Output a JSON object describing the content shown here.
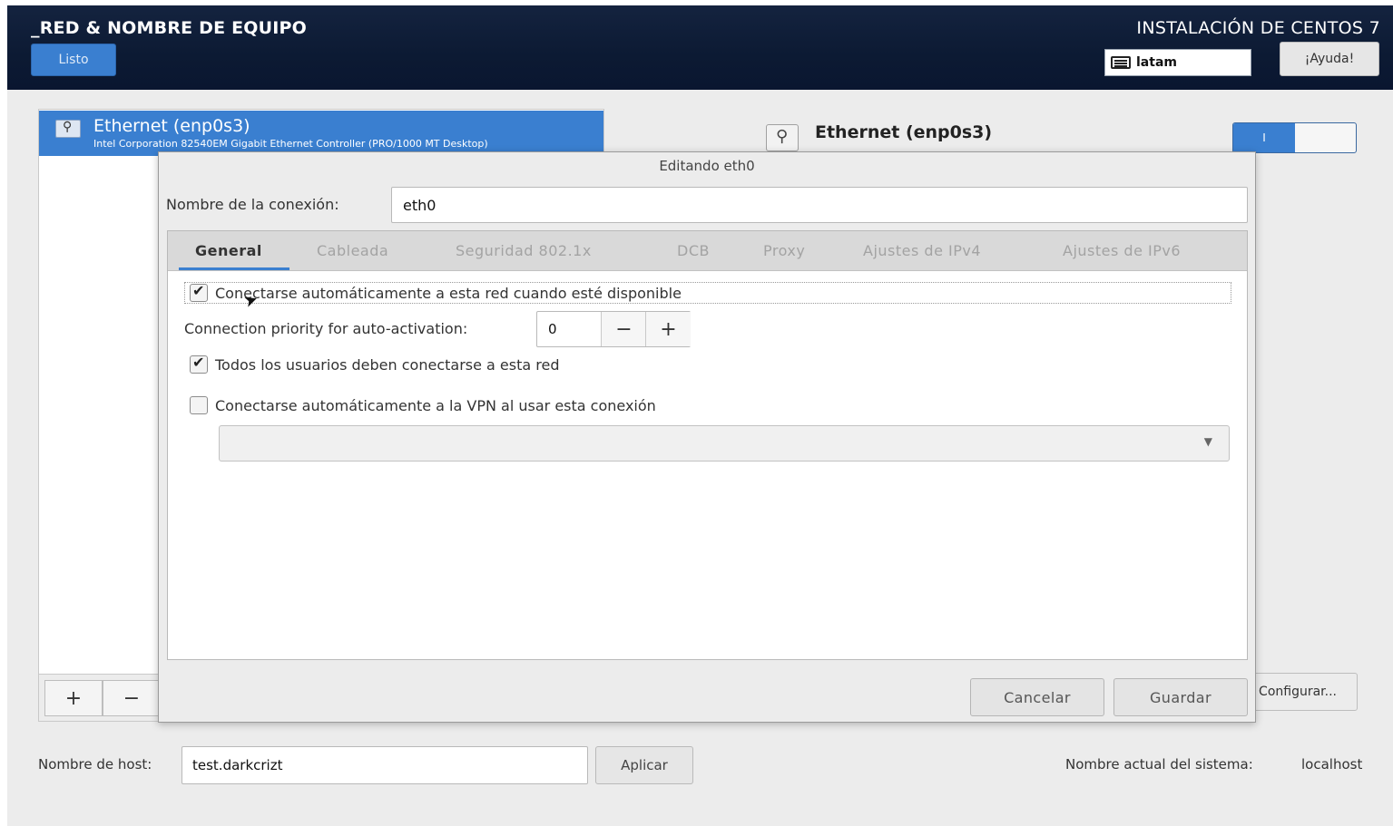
{
  "header": {
    "title": "_RED & NOMBRE DE EQUIPO",
    "done_label": "Listo",
    "install_title": "INSTALACIÓN DE CENTOS 7",
    "keyboard_layout": "latam",
    "help_label": "¡Ayuda!"
  },
  "device_list": {
    "items": [
      {
        "name": "Ethernet (enp0s3)",
        "description": "Intel Corporation 82540EM Gigabit Ethernet Controller (PRO/1000 MT Desktop)"
      }
    ],
    "add_label": "+",
    "remove_label": "−"
  },
  "device_detail": {
    "name": "Ethernet (enp0s3)",
    "toggle_on_text": "I",
    "configure_label": "Configurar..."
  },
  "hostname": {
    "label": "Nombre de host:",
    "value": "test.darkcrizt",
    "apply_label": "Aplicar",
    "current_label": "Nombre actual del sistema:",
    "current_value": "localhost"
  },
  "dialog": {
    "title": "Editando eth0",
    "connection_name_label": "Nombre de la conexión:",
    "connection_name_value": "eth0",
    "tabs": [
      {
        "label": "General"
      },
      {
        "label": "Cableada"
      },
      {
        "label": "Seguridad 802.1x"
      },
      {
        "label": "DCB"
      },
      {
        "label": "Proxy"
      },
      {
        "label": "Ajustes de IPv4"
      },
      {
        "label": "Ajustes de IPv6"
      }
    ],
    "auto_connect_label": "Conectarse automáticamente a esta red cuando esté disponible",
    "auto_connect_checked": true,
    "priority_label": "Connection priority for auto-activation:",
    "priority_value": "0",
    "all_users_label": "Todos los usuarios deben conectarse a esta red",
    "all_users_checked": true,
    "vpn_label": "Conectarse automáticamente a la VPN al usar esta conexión",
    "vpn_checked": false,
    "cancel_label": "Cancelar",
    "save_label": "Guardar"
  },
  "colors": {
    "header_bg": "#0c1a33",
    "accent": "#3a7fd0",
    "dialog_bg": "#ececec"
  }
}
